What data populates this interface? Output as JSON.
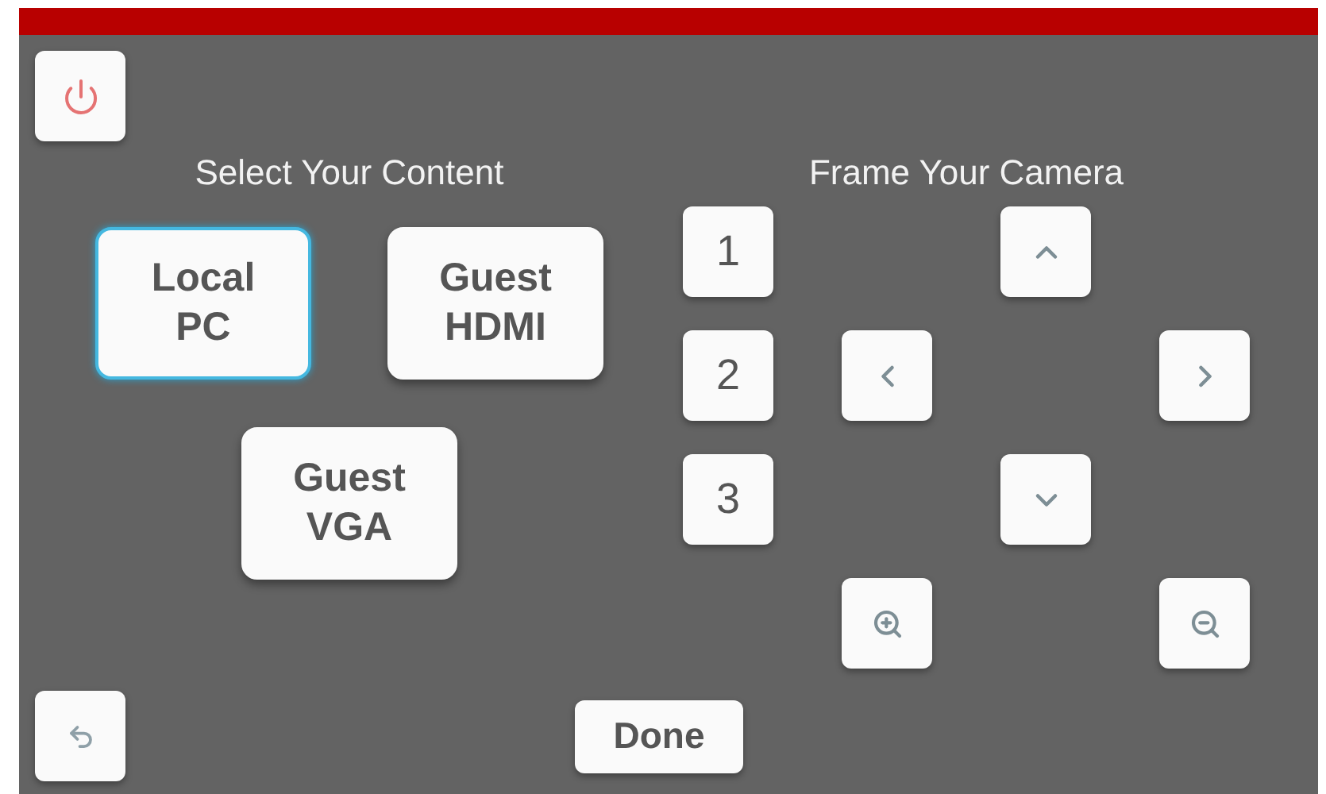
{
  "content": {
    "title": "Select Your Content",
    "sources": [
      {
        "label": "Local PC",
        "selected": true
      },
      {
        "label": "Guest HDMI",
        "selected": false
      },
      {
        "label": "Guest VGA",
        "selected": false
      }
    ]
  },
  "camera": {
    "title": "Frame Your Camera",
    "presets": [
      "1",
      "2",
      "3"
    ],
    "controls": [
      {
        "kind": "up"
      },
      {
        "kind": "left"
      },
      {
        "kind": "right"
      },
      {
        "kind": "down"
      },
      {
        "kind": "zoom_in"
      },
      {
        "kind": "zoom_out"
      }
    ]
  },
  "done_button": "Done"
}
